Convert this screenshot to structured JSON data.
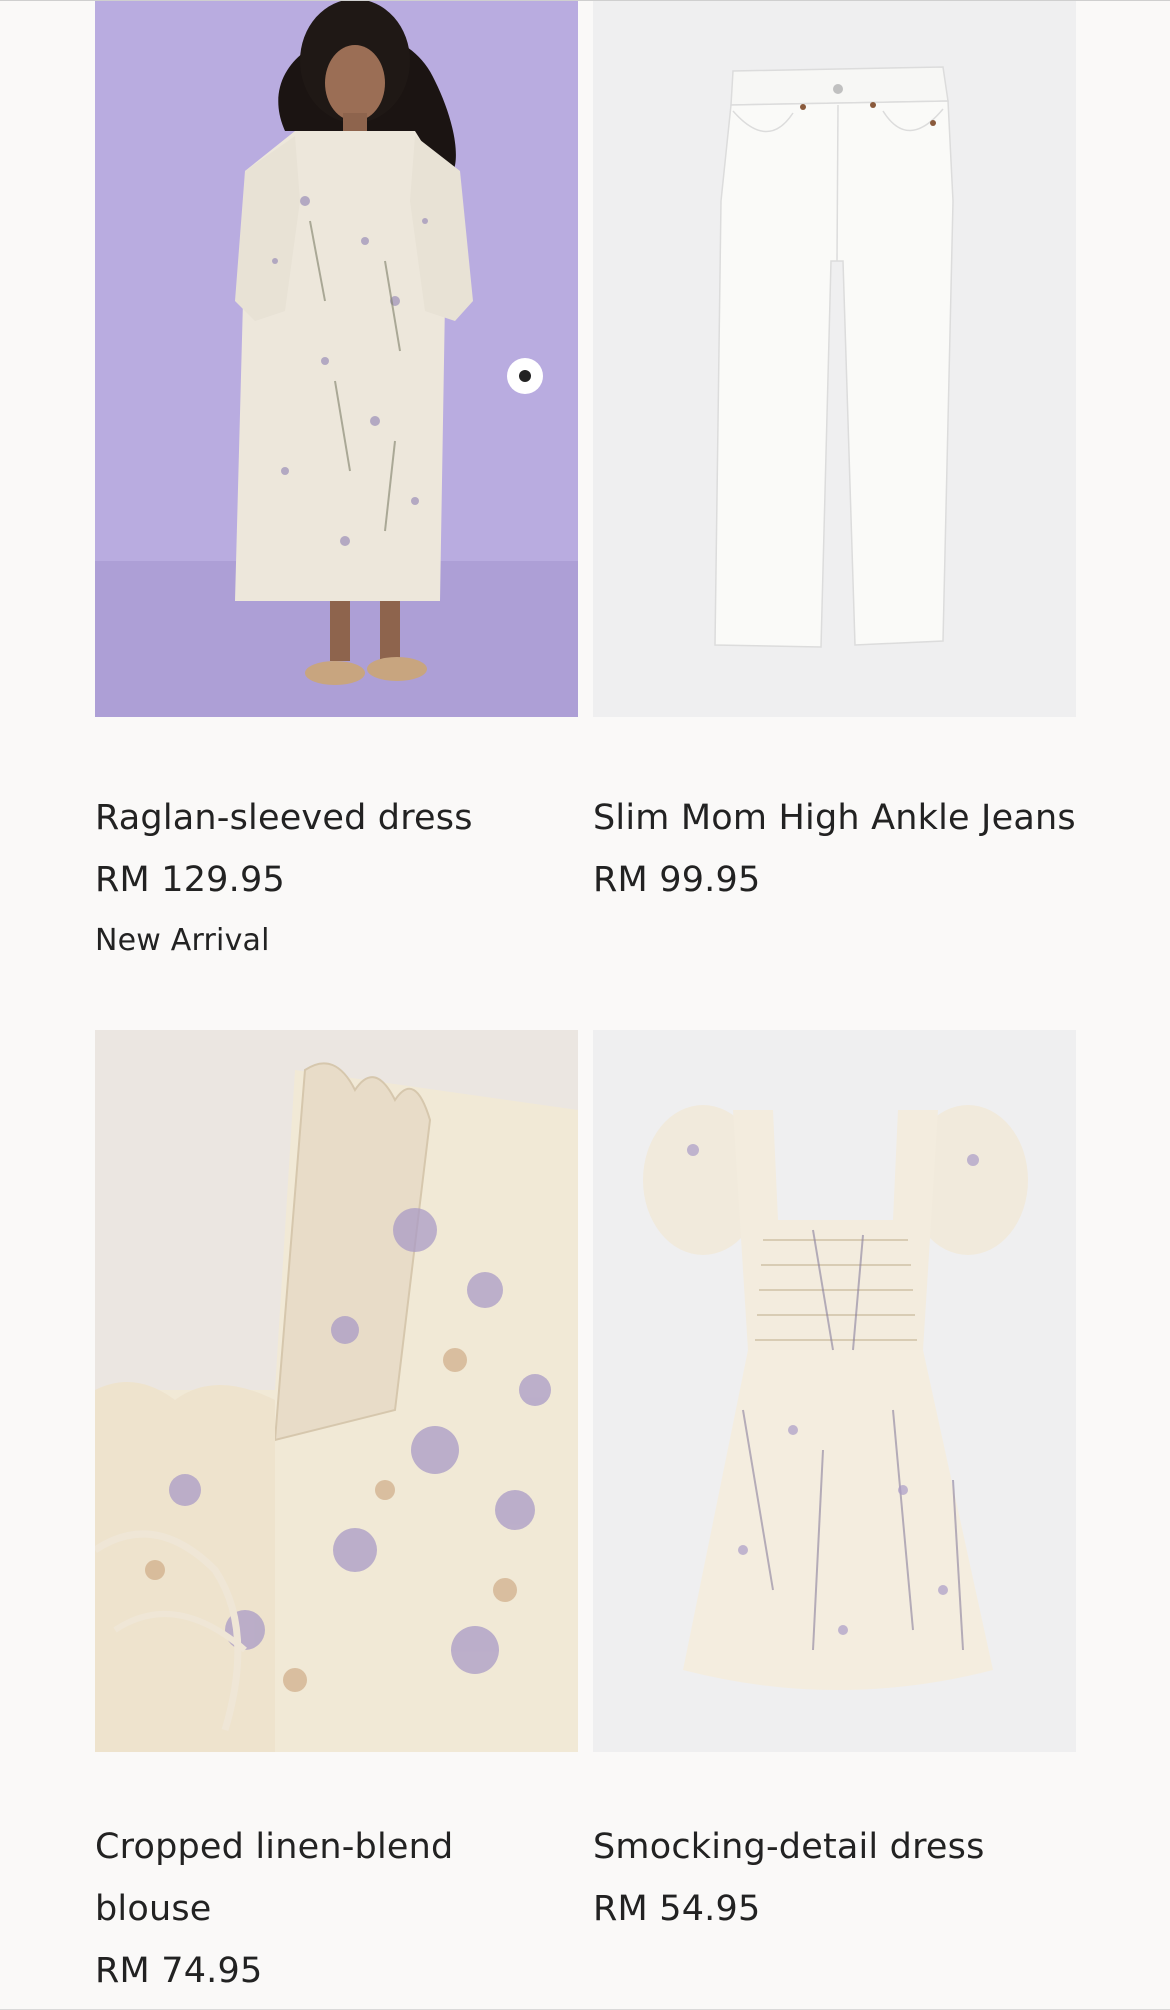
{
  "products": [
    {
      "name": "Raglan-sleeved dress",
      "price": "RM 129.95",
      "badge": "New Arrival",
      "image_icon": "floral-dress-model-photo",
      "bg_color": "#b9ace0"
    },
    {
      "name": "Slim Mom High Ankle Jeans",
      "price": "RM 99.95",
      "image_icon": "white-jeans-photo",
      "bg_color": "#efeff0"
    },
    {
      "name": "Cropped linen-blend blouse",
      "price": "RM 74.95",
      "image_icon": "floral-blouse-closeup-photo",
      "bg_color": "#ebe6e1"
    },
    {
      "name": "Smocking-detail dress",
      "price": "RM 54.95",
      "image_icon": "floral-mini-dress-photo",
      "bg_color": "#efeff0"
    }
  ]
}
